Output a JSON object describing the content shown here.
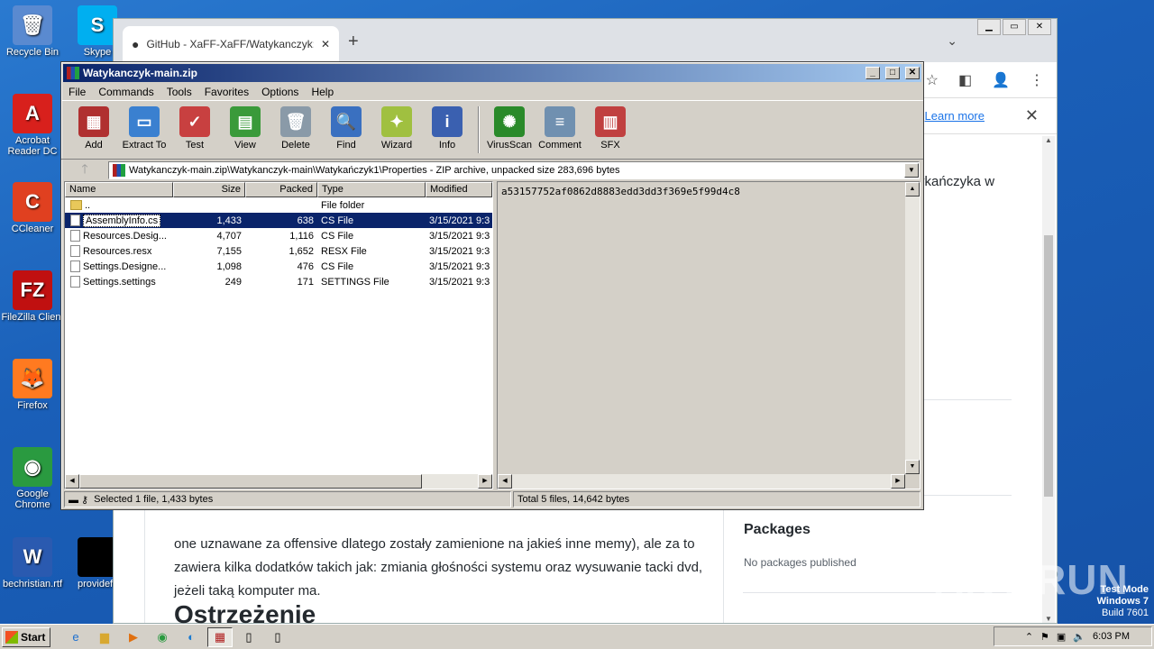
{
  "desktop": {
    "icons": [
      {
        "label": "Recycle Bin",
        "icon": "recycle-bin-icon",
        "color": "#5a8ad0",
        "glyph": "🗑"
      },
      {
        "label": "Acrobat Reader DC",
        "icon": "acrobat-icon",
        "color": "#d8201c",
        "glyph": "A"
      },
      {
        "label": "CCleaner",
        "icon": "ccleaner-icon",
        "color": "#e04020",
        "glyph": "C"
      },
      {
        "label": "FileZilla Client",
        "icon": "filezilla-icon",
        "color": "#c01010",
        "glyph": "FZ"
      },
      {
        "label": "Firefox",
        "icon": "firefox-icon",
        "color": "#ff7a20",
        "glyph": "🦊"
      },
      {
        "label": "Google Chrome",
        "icon": "chrome-icon",
        "color": "#2a9a40",
        "glyph": "◉"
      },
      {
        "label": "bechristian.rtf",
        "icon": "word-doc-icon",
        "color": "#2a5ab0",
        "glyph": "W"
      },
      {
        "label": "Skype",
        "icon": "skype-icon",
        "color": "#00aff0",
        "glyph": "S"
      },
      {
        "label": "providefil",
        "icon": "black-file-icon",
        "color": "#000000",
        "glyph": ""
      }
    ]
  },
  "browser": {
    "tab_title": "GitHub - XaFF-XaFF/Watykanczyk: R",
    "new_tab": "+",
    "learn_more": "Learn more",
    "side_fragment": "ykańczyka w",
    "body_text": "one uznawane za offensive dlatego zostały zamienione na jakieś inne memy), ale za to zawiera kilka dodatków takich jak: zmiania głośności systemu oraz wysuwanie tacki dvd, jeżeli taką komputer ma.",
    "heading": "Ostrzeżenie",
    "packages_title": "Packages",
    "packages_sub": "No packages published"
  },
  "winrar": {
    "title": "Watykanczyk-main.zip",
    "menu": [
      "File",
      "Commands",
      "Tools",
      "Favorites",
      "Options",
      "Help"
    ],
    "toolbar": [
      {
        "label": "Add",
        "icon": "add-archive-icon",
        "color": "#b03030",
        "glyph": "▦"
      },
      {
        "label": "Extract To",
        "icon": "extract-folder-icon",
        "color": "#3a80d0",
        "glyph": "▭"
      },
      {
        "label": "Test",
        "icon": "test-clipboard-icon",
        "color": "#c84040",
        "glyph": "✓"
      },
      {
        "label": "View",
        "icon": "view-book-icon",
        "color": "#3a9a3a",
        "glyph": "▤"
      },
      {
        "label": "Delete",
        "icon": "delete-bin-icon",
        "color": "#8a9aa8",
        "glyph": "🗑"
      },
      {
        "label": "Find",
        "icon": "find-magnifier-icon",
        "color": "#3a70c0",
        "glyph": "🔍"
      },
      {
        "label": "Wizard",
        "icon": "wizard-wand-icon",
        "color": "#a0c040",
        "glyph": "✦"
      },
      {
        "label": "Info",
        "icon": "info-icon",
        "color": "#3a60b0",
        "glyph": "i"
      }
    ],
    "toolbar2": [
      {
        "label": "VirusScan",
        "icon": "virusscan-bug-icon",
        "color": "#2a8a2a",
        "glyph": "✺"
      },
      {
        "label": "Comment",
        "icon": "comment-icon",
        "color": "#7090b0",
        "glyph": "≡"
      },
      {
        "label": "SFX",
        "icon": "sfx-books-icon",
        "color": "#c04040",
        "glyph": "▥"
      }
    ],
    "address": "Watykanczyk-main.zip\\Watykanczyk-main\\Watykańczyk1\\Properties - ZIP archive, unpacked size 283,696 bytes",
    "columns": {
      "name": "Name",
      "size": "Size",
      "packed": "Packed",
      "type": "Type",
      "modified": "Modified"
    },
    "rows": [
      {
        "name": "..",
        "size": "",
        "packed": "",
        "type": "File folder",
        "modified": "",
        "folder": true
      },
      {
        "name": "AssemblyInfo.cs",
        "size": "1,433",
        "packed": "638",
        "type": "CS File",
        "modified": "3/15/2021 9:3"
      },
      {
        "name": "Resources.Desig...",
        "size": "4,707",
        "packed": "1,116",
        "type": "CS File",
        "modified": "3/15/2021 9:3"
      },
      {
        "name": "Resources.resx",
        "size": "7,155",
        "packed": "1,652",
        "type": "RESX File",
        "modified": "3/15/2021 9:3"
      },
      {
        "name": "Settings.Designe...",
        "size": "1,098",
        "packed": "476",
        "type": "CS File",
        "modified": "3/15/2021 9:3"
      },
      {
        "name": "Settings.settings",
        "size": "249",
        "packed": "171",
        "type": "SETTINGS File",
        "modified": "3/15/2021 9:3"
      }
    ],
    "preview_hash": "a53157752af0862d8883edd3dd3f369e5f99d4c8",
    "status_left": "Selected 1 file, 1,433 bytes",
    "status_right": "Total 5 files, 14,642 bytes"
  },
  "taskbar": {
    "start": "Start",
    "clock": "6:03 PM",
    "watermark_line1": "Test Mode",
    "watermark_line2": "Windows 7",
    "watermark_line3": "Build 7601",
    "anyrun": "ANY RUN"
  }
}
